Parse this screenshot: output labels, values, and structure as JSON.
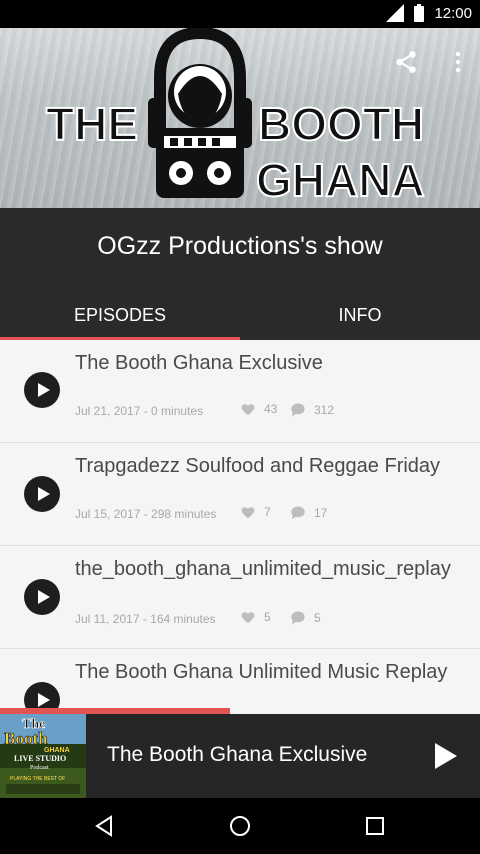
{
  "status_bar": {
    "time": "12:00",
    "icons": [
      "signal-icon",
      "battery-icon"
    ]
  },
  "header": {
    "logo_text_left": "THE",
    "logo_text_right_top": "BOOTH",
    "logo_text_right_bottom": "GHANA",
    "actions": [
      "share-icon",
      "more-vert-icon"
    ]
  },
  "show": {
    "title": "OGzz Productions's show"
  },
  "tabs": [
    {
      "label": "EPISODES",
      "selected": true
    },
    {
      "label": "INFO",
      "selected": false
    }
  ],
  "episodes": [
    {
      "title": "The Booth Ghana Exclusive",
      "meta": "Jul 21, 2017 - 0 minutes",
      "likes": "43",
      "comments": "312"
    },
    {
      "title": "Trapgadezz Soulfood and Reggae Friday",
      "meta": "Jul 15, 2017 - 298 minutes",
      "likes": "7",
      "comments": "17"
    },
    {
      "title": "the_booth_ghana_unlimited_music_replay",
      "meta": "Jul 11, 2017 - 164 minutes",
      "likes": "5",
      "comments": "5"
    },
    {
      "title": "The Booth Ghana Unlimited Music Replay",
      "meta": "",
      "likes": "",
      "comments": ""
    }
  ],
  "player": {
    "title": "The Booth Ghana Exclusive",
    "progress": 0.48,
    "thumb_text_top": "The",
    "thumb_text_mid": "Booth",
    "thumb_text_ghana": "GHANA",
    "thumb_text_studio": "LIVE STUDIO",
    "thumb_text_podcast": "Podcast",
    "thumb_text_playing": "PLAYING THE BEST OF"
  },
  "nav": [
    "back-icon",
    "home-icon",
    "recents-icon"
  ],
  "colors": {
    "accent": "#e25454",
    "toolbar": "#2a2a2a",
    "list_bg": "#f5f5f5"
  }
}
